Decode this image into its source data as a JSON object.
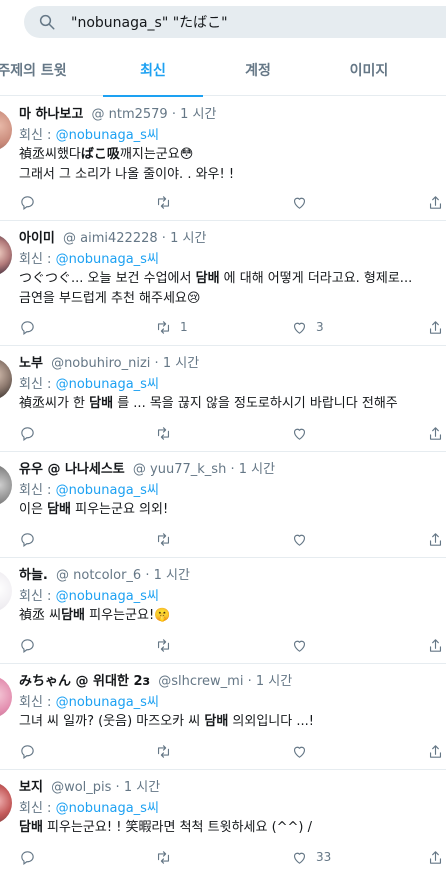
{
  "search": {
    "query": "\"nobunaga_s\" \"たばこ\""
  },
  "tabs": [
    {
      "label": "주제의 트윗"
    },
    {
      "label": "최신"
    },
    {
      "label": "계정"
    },
    {
      "label": "이미지"
    }
  ],
  "tweets": [
    {
      "name": "마 하나보고",
      "handle": "@ ntm2579",
      "time": "1 시간",
      "reply_prefix": "회신 :",
      "mention": "@nobunaga_s씨",
      "line1": "禎丞씨했다ばこ吸깨지는군요😳",
      "line2": "그래서 그 소리가 나올 줄이야. . 와우! !",
      "reply_count": "",
      "retweet_count": "",
      "like_count": ""
    },
    {
      "name": "아이미",
      "handle": "@ aimi422228",
      "time": "1 시간",
      "reply_prefix": "회신 :",
      "mention": "@nobunaga_s씨",
      "line1": "つぐつぐ... 오늘 보건 수업에서 담배 에 대해 어떻게 더라고요. 형제로...",
      "line2": "금연을 부드럽게 추천 해주세요😢",
      "reply_count": "",
      "retweet_count": "1",
      "like_count": "3"
    },
    {
      "name": "노부",
      "handle": "@nobuhiro_nizi",
      "time": "1 시간",
      "reply_prefix": "회신 :",
      "mention": "@nobunaga_s씨",
      "line1": "禎丞씨가 한 담배 를 ... 목을 끊지 않을 정도로하시기 바랍니다 전해주",
      "line2": "",
      "reply_count": "",
      "retweet_count": "",
      "like_count": ""
    },
    {
      "name": "유우 @ 나나세스토",
      "handle": "@ yuu77_k_sh",
      "time": "1 시간",
      "reply_prefix": "회신 :",
      "mention": "@nobunaga_s씨",
      "line1": "이은 담배 피우는군요 의외!",
      "line2": "",
      "reply_count": "",
      "retweet_count": "",
      "like_count": ""
    },
    {
      "name": "하늘.",
      "handle": "@ notcolor_6",
      "time": "1 시간",
      "reply_prefix": "회신 :",
      "mention": "@nobunaga_s씨",
      "line1": "禎丞 씨담배 피우는군요!🤫",
      "line2": "",
      "reply_count": "",
      "retweet_count": "",
      "like_count": ""
    },
    {
      "name": "みちゃん @ 위대한 2з",
      "handle": "@slhcrew_mi",
      "time": "1 시간",
      "reply_prefix": "회신 :",
      "mention": "@nobunaga_s씨",
      "line1": "그녀 씨 일까? (웃음) 마즈오카 씨 담배 의외입니다 ...!",
      "line2": "",
      "reply_count": "",
      "retweet_count": "",
      "like_count": ""
    },
    {
      "name": "보지",
      "handle": "@wol_pis",
      "time": "1 시간",
      "reply_prefix": "회신 :",
      "mention": "@nobunaga_s씨",
      "line1": "담배 피우는군요! ! 笑暇라면 척척 트윗하세요 (^^) /",
      "line2": "",
      "reply_count": "",
      "retweet_count": "",
      "like_count": "33"
    }
  ],
  "separator": "·",
  "colors": {
    "accent": "#1da1f2",
    "muted": "#657786",
    "border": "#e6ecf0",
    "search_bg": "#e6ecf0"
  },
  "icons": [
    "search-icon",
    "reply-icon",
    "retweet-icon",
    "like-icon",
    "share-icon"
  ]
}
